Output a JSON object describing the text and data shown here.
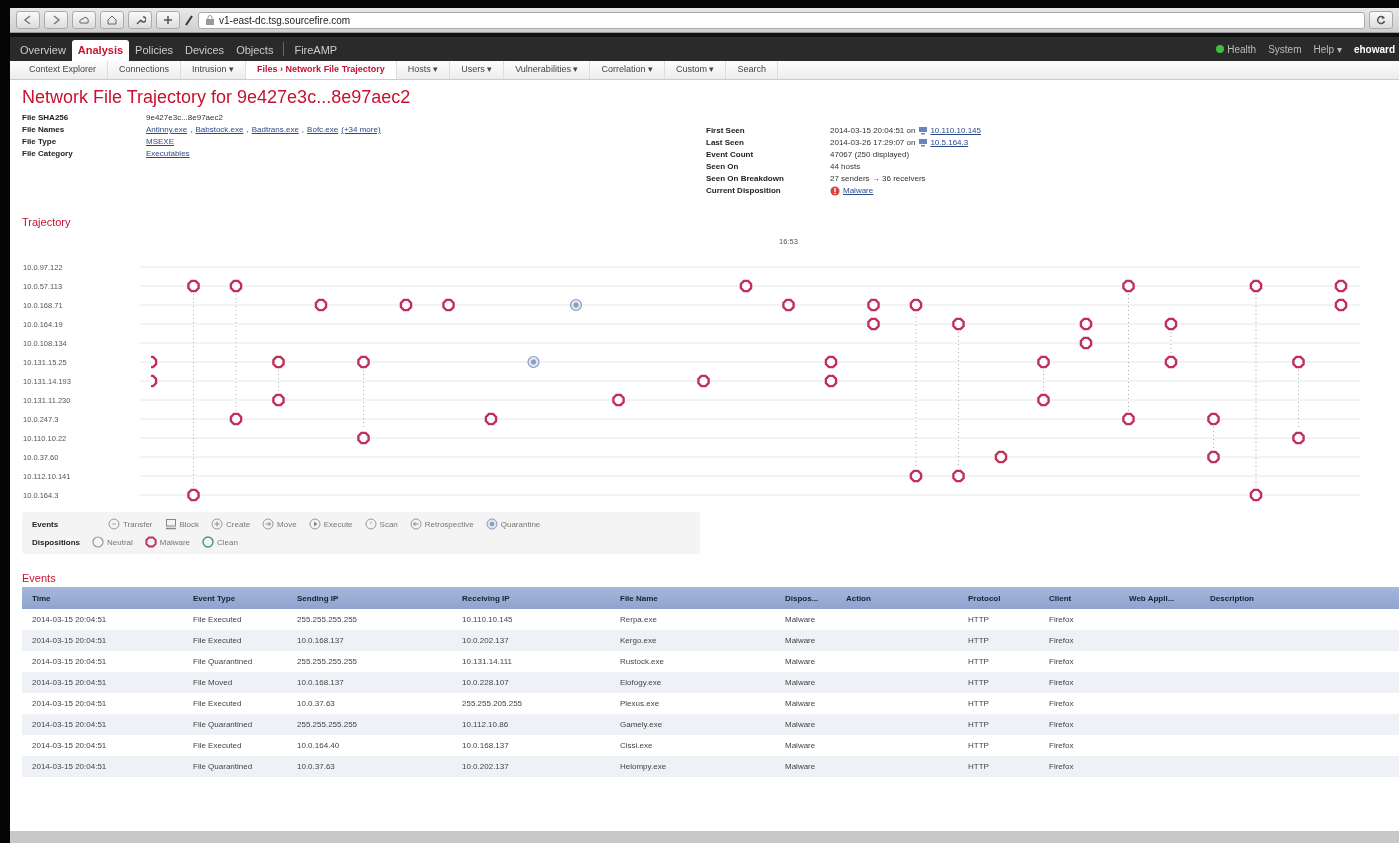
{
  "browser": {
    "url": "v1-east-dc.tsg.sourcefire.com"
  },
  "nav": {
    "tabs": [
      {
        "label": "Overview",
        "selected": false
      },
      {
        "label": "Analysis",
        "selected": true
      },
      {
        "label": "Policies",
        "selected": false
      },
      {
        "label": "Devices",
        "selected": false
      },
      {
        "label": "Objects",
        "selected": false
      },
      {
        "label": "FireAMP",
        "selected": false
      }
    ],
    "right": [
      {
        "label": "Health",
        "kind": "status"
      },
      {
        "label": "System",
        "kind": "plain"
      },
      {
        "label": "Help ▾",
        "kind": "plain"
      },
      {
        "label": "ehoward",
        "kind": "user"
      }
    ]
  },
  "subnav": [
    {
      "label": "Context Explorer",
      "selected": false
    },
    {
      "label": "Connections",
      "selected": false
    },
    {
      "label": "Intrusion ▾",
      "selected": false
    },
    {
      "label": "Files › Network File Trajectory",
      "selected": true
    },
    {
      "label": "Hosts ▾",
      "selected": false
    },
    {
      "label": "Users ▾",
      "selected": false
    },
    {
      "label": "Vulnerabilities ▾",
      "selected": false
    },
    {
      "label": "Correlation ▾",
      "selected": false
    },
    {
      "label": "Custom ▾",
      "selected": false
    },
    {
      "label": "Search",
      "selected": false
    }
  ],
  "title": "Network File Trajectory for 9e427e3c...8e97aec2",
  "summary": {
    "left": [
      {
        "label": "File SHA256",
        "value": [
          {
            "text": "9e427e3c...8e97aec2",
            "kind": "plain"
          }
        ]
      },
      {
        "label": "File Names",
        "value": [
          {
            "text": "Antinny.exe",
            "kind": "link"
          },
          {
            "text": ",",
            "kind": "plain"
          },
          {
            "text": "Babstock.exe",
            "kind": "link"
          },
          {
            "text": ",",
            "kind": "plain"
          },
          {
            "text": "Badtrans.exe",
            "kind": "link"
          },
          {
            "text": ",",
            "kind": "plain"
          },
          {
            "text": "Bofc.exe",
            "kind": "link"
          },
          {
            "text": "(+34 more)",
            "kind": "link"
          }
        ]
      },
      {
        "label": "File Type",
        "value": [
          {
            "text": "MSEXE",
            "kind": "link"
          }
        ]
      },
      {
        "label": "File Category",
        "value": [
          {
            "text": "Executables",
            "kind": "link"
          }
        ]
      }
    ],
    "right": [
      {
        "label": "First Seen",
        "value": [
          {
            "text": "2014-03-15 20:04:51 on",
            "kind": "plain"
          },
          {
            "text": "10.110.10.145",
            "kind": "host"
          }
        ]
      },
      {
        "label": "Last Seen",
        "value": [
          {
            "text": "2014-03-26 17:29:07 on",
            "kind": "plain"
          },
          {
            "text": "10.5.164.3",
            "kind": "host"
          }
        ]
      },
      {
        "label": "Event Count",
        "value": [
          {
            "text": "47067 (250 displayed)",
            "kind": "plain"
          }
        ]
      },
      {
        "label": "Seen On",
        "value": [
          {
            "text": "44 hosts",
            "kind": "plain"
          }
        ]
      },
      {
        "label": "Seen On Breakdown",
        "value": [
          {
            "text": "27 senders → 36 receivers",
            "kind": "plain"
          }
        ]
      },
      {
        "label": "Current Disposition",
        "value": [
          {
            "text": "Malware",
            "kind": "malware"
          }
        ]
      }
    ]
  },
  "trajectory": {
    "title": "Trajectory",
    "time_label": "16:53",
    "hosts": [
      "10.0.97.122",
      "10.0.57.113",
      "10.0.168.71",
      "10.0.164.19",
      "10.0.108.134",
      "10.131.15.25",
      "10.131.14.193",
      "10.131.11.230",
      "10.0.247.3",
      "10.110.10.22",
      "10.0.37.60",
      "10.112.10.141",
      "10.0.164.3"
    ]
  },
  "legend": [
    {
      "label": "Events",
      "items": [
        {
          "label": "Transfer",
          "kind": "transfer"
        },
        {
          "label": "Block",
          "kind": "block"
        },
        {
          "label": "Create",
          "kind": "create"
        },
        {
          "label": "Move",
          "kind": "move"
        },
        {
          "label": "Execute",
          "kind": "execute"
        },
        {
          "label": "Scan",
          "kind": "scan"
        },
        {
          "label": "Retrospective",
          "kind": "retrospective"
        },
        {
          "label": "Quarantine",
          "kind": "quarantine"
        }
      ]
    },
    {
      "label": "Dispositions",
      "items": [
        {
          "label": "Neutral",
          "kind": "neutral",
          "color": "#9a9a9a"
        },
        {
          "label": "Malware",
          "kind": "malware",
          "color": "#c0305a"
        },
        {
          "label": "Clean",
          "kind": "clean",
          "color": "#3a9a70"
        }
      ]
    }
  ],
  "events": {
    "title": "Events",
    "columns": [
      "Time",
      "Event Type",
      "Sending IP",
      "Receiving IP",
      "File Name",
      "Dispos...",
      "Action",
      "Protocol",
      "Client",
      "Web Appli...",
      "Description"
    ],
    "rows": [
      [
        "2014-03-15 20:04:51",
        "File Executed",
        "255.255.255.255",
        "10.110.10.145",
        "Rerpa.exe",
        "Malware",
        null,
        "HTTP",
        "Firefox",
        null,
        null
      ],
      [
        "2014-03-15 20:04:51",
        "File Executed",
        "10.0.168.137",
        "10.0.202.137",
        "Kergo.exe",
        "Malware",
        null,
        "HTTP",
        "Firefox",
        null,
        null
      ],
      [
        "2014-03-15 20:04:51",
        "File Quarantined",
        "255.255.255.255",
        "10.131.14.111",
        "Rustock.exe",
        "Malware",
        null,
        "HTTP",
        "Firefox",
        null,
        null
      ],
      [
        "2014-03-15 20:04:51",
        "File Moved",
        "10.0.168.137",
        "10.0.228.107",
        "Elofogy.exe",
        "Malware",
        null,
        "HTTP",
        "Firefox",
        null,
        null
      ],
      [
        "2014-03-15 20:04:51",
        "File Executed",
        "10.0.37.63",
        "255.255.205.255",
        "Plexus.exe",
        "Malware",
        null,
        "HTTP",
        "Firefox",
        null,
        null
      ],
      [
        "2014-03-15 20:04:51",
        "File Quarantined",
        "255.255.255.255",
        "10.112.10.86",
        "Gamely.exe",
        "Malware",
        null,
        "HTTP",
        "Firefox",
        null,
        null
      ],
      [
        "2014-03-15 20:04:51",
        "File Executed",
        "10.0.164.40",
        "10.0.168.137",
        "Cissi.exe",
        "Malware",
        null,
        "HTTP",
        "Firefox",
        null,
        null
      ],
      [
        "2014-03-15 20:04:51",
        "File Quarantined",
        "10.0.37.63",
        "10.0.202.137",
        "Helompy.exe",
        "Malware",
        null,
        "HTTP",
        "Firefox",
        null,
        null
      ]
    ]
  }
}
